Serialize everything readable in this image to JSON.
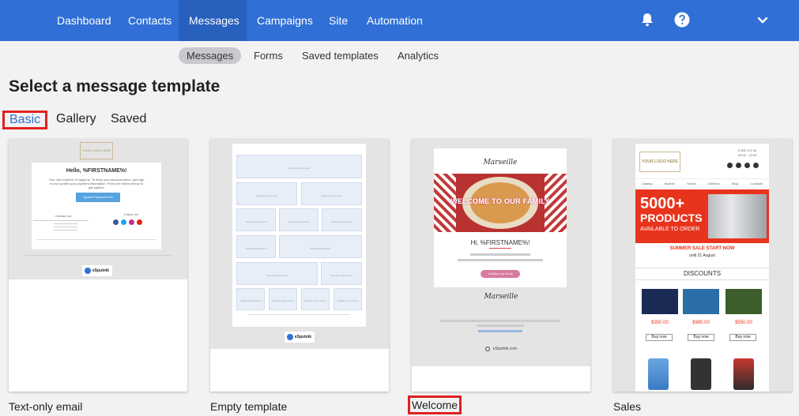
{
  "nav": {
    "items": [
      "Dashboard",
      "Contacts",
      "Messages",
      "Campaigns",
      "Site",
      "Automation"
    ],
    "icons": [
      "bell-icon",
      "help-icon",
      "chevron-down-icon"
    ]
  },
  "subnav": {
    "items": [
      "Messages",
      "Forms",
      "Saved templates",
      "Analytics"
    ]
  },
  "page": {
    "title": "Select a message template"
  },
  "tabs": [
    "Basic",
    "Gallery",
    "Saved"
  ],
  "cards": [
    {
      "label": "Text-only email",
      "logo": "YOUR LOGO HERE",
      "greeting": "Hello, %FIRSTNAME%!",
      "body": "Your card expired. It happens. To keep your account active, just sign in and update your payment information. Press the button below to get started.",
      "button": "Update Payment Info",
      "contact_title": "Contact Us:",
      "follow_title": "Follow Us:",
      "brand": "eSputnik"
    },
    {
      "label": "Empty template",
      "placeholder": "Upload content here",
      "brand": "eSputnik"
    },
    {
      "label": "Welcome",
      "brand_name": "Marseille",
      "banner": "WELCOME TO OUR FAMILY",
      "greeting": "Hi, %FIRSTNAME%!",
      "button": "Confirm my email",
      "footer_brand": "eSputnik.com"
    },
    {
      "label": "Sales",
      "logo": "YOUR LOGO HERE",
      "phone": "0 800 123 45",
      "hours": "09:00 - 22:00",
      "menu": [
        "Catalog",
        "Brands",
        "Stores",
        "Delivery",
        "Blog",
        "Contacts"
      ],
      "banner_big": "5000+",
      "banner_mid": "PRODUCTS",
      "banner_sub": "AVAILABLE TO ORDER",
      "promo": "SUMMER SALE START NOW",
      "promo_date": "until 21 August",
      "section": "DISCOUNTS",
      "prices": [
        "$350.00",
        "$980.00",
        "$550.00"
      ],
      "buy": "Buy now"
    }
  ],
  "colors": {
    "nav": "#2f6fd6",
    "nav_active": "#2860bd",
    "highlight": "#e02020",
    "accent": "#2f6fd6"
  }
}
